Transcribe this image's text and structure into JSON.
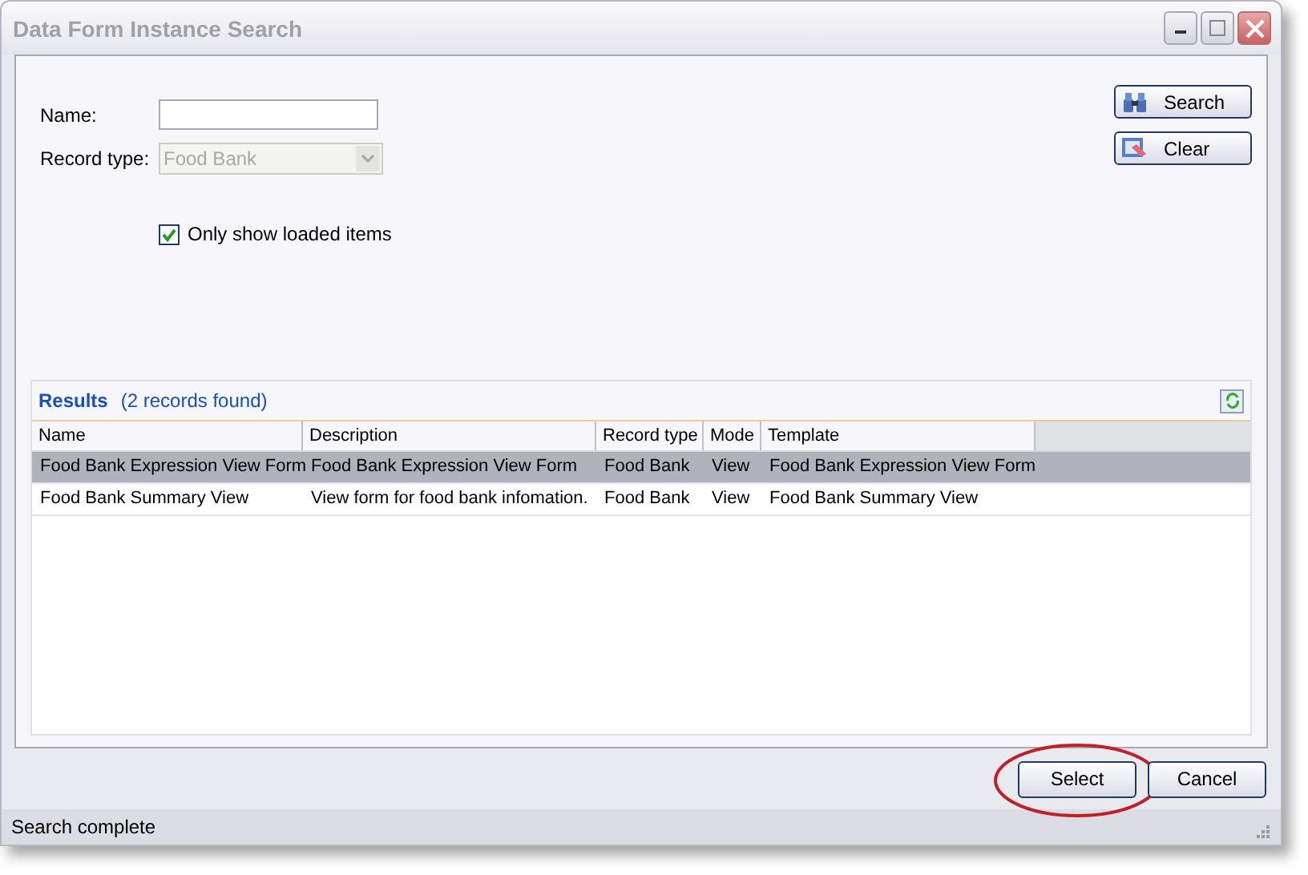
{
  "window": {
    "title": "Data Form Instance Search"
  },
  "form": {
    "name": {
      "label": "Name:"
    },
    "record_type": {
      "label": "Record type:",
      "value": "Food Bank",
      "disabled": true
    },
    "only_loaded": {
      "label": "Only show loaded items",
      "checked": true
    }
  },
  "side_buttons": [
    {
      "kind": "search",
      "label": "Search"
    },
    {
      "kind": "clear",
      "label": "Clear"
    }
  ],
  "results": {
    "title": "Results",
    "count": "(2 records found)",
    "columns": [
      "Name",
      "Description",
      "Record type",
      "Mode",
      "Template"
    ],
    "rows": [
      {
        "cells": [
          "Food Bank Expression View Form",
          "Food Bank Expression View Form",
          "Food Bank",
          "View",
          "Food Bank Expression View Form"
        ],
        "selected": true
      },
      {
        "cells": [
          "Food Bank Summary View",
          "View form for food bank infomation.",
          "Food Bank",
          "View",
          "Food Bank Summary View"
        ],
        "selected": false
      }
    ]
  },
  "buttons": [
    {
      "label": "Select",
      "highlighted": true
    },
    {
      "label": "Cancel",
      "highlighted": false
    }
  ],
  "status_bar": "Search complete"
}
